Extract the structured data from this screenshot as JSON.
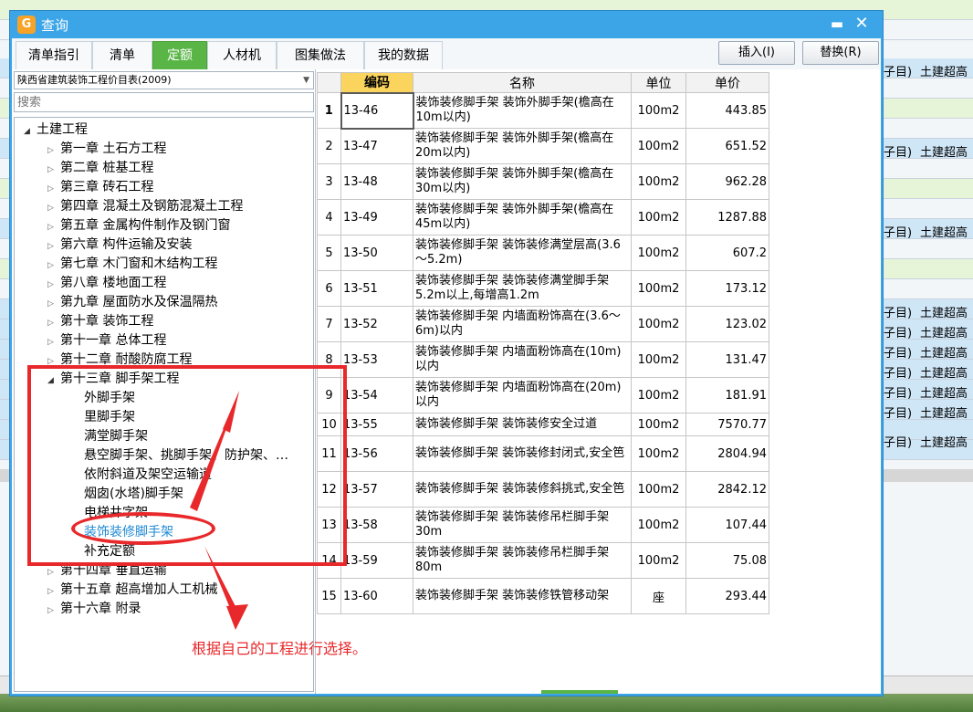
{
  "window": {
    "title": "查询",
    "icon": "app-icon"
  },
  "tabs": [
    "清单指引",
    "清单",
    "定额",
    "人材机",
    "图集做法",
    "我的数据"
  ],
  "active_tab": "定额",
  "buttons": {
    "insert": "插入(I)",
    "replace": "替换(R)"
  },
  "library": {
    "selected": "陕西省建筑装饰工程价目表(2009)"
  },
  "search": {
    "placeholder": "搜索"
  },
  "tree": {
    "root": "土建工程",
    "chapters": [
      "第一章 土石方工程",
      "第二章 桩基工程",
      "第三章 砖石工程",
      "第四章 混凝土及钢筋混凝土工程",
      "第五章 金属构件制作及钢门窗",
      "第六章 构件运输及安装",
      "第七章 木门窗和木结构工程",
      "第八章 楼地面工程",
      "第九章 屋面防水及保温隔热",
      "第十章 装饰工程",
      "第十一章 总体工程",
      "第十二章 耐酸防腐工程"
    ],
    "open_chapter": "第十三章 脚手架工程",
    "open_children": [
      "外脚手架",
      "里脚手架",
      "满堂脚手架",
      "悬空脚手架、挑脚手架、防护架、…",
      "依附斜道及架空运输道",
      "烟囱(水塔)脚手架",
      "电梯井字架",
      "装饰装修脚手架",
      "补充定额"
    ],
    "selected_child": "装饰装修脚手架",
    "after_chapters": [
      "第十四章 垂直运输",
      "第十五章 超高增加人工机械",
      "第十六章 附录"
    ]
  },
  "grid": {
    "headers": {
      "code": "编码",
      "name": "名称",
      "unit": "单位",
      "price": "单价"
    },
    "rows": [
      {
        "n": "1",
        "code": "13-46",
        "name": "装饰装修脚手架 装饰外脚手架(檐高在10m以内)",
        "unit": "100m2",
        "price": "443.85"
      },
      {
        "n": "2",
        "code": "13-47",
        "name": "装饰装修脚手架 装饰外脚手架(檐高在20m以内)",
        "unit": "100m2",
        "price": "651.52"
      },
      {
        "n": "3",
        "code": "13-48",
        "name": "装饰装修脚手架 装饰外脚手架(檐高在30m以内)",
        "unit": "100m2",
        "price": "962.28"
      },
      {
        "n": "4",
        "code": "13-49",
        "name": "装饰装修脚手架 装饰外脚手架(檐高在45m以内)",
        "unit": "100m2",
        "price": "1287.88"
      },
      {
        "n": "5",
        "code": "13-50",
        "name": "装饰装修脚手架 装饰装修满堂层高(3.6～5.2m)",
        "unit": "100m2",
        "price": "607.2"
      },
      {
        "n": "6",
        "code": "13-51",
        "name": "装饰装修脚手架 装饰装修满堂脚手架5.2m以上,每增高1.2m",
        "unit": "100m2",
        "price": "173.12"
      },
      {
        "n": "7",
        "code": "13-52",
        "name": "装饰装修脚手架 内墙面粉饰高在(3.6～6m)以内",
        "unit": "100m2",
        "price": "123.02"
      },
      {
        "n": "8",
        "code": "13-53",
        "name": "装饰装修脚手架 内墙面粉饰高在(10m)以内",
        "unit": "100m2",
        "price": "131.47"
      },
      {
        "n": "9",
        "code": "13-54",
        "name": "装饰装修脚手架 内墙面粉饰高在(20m)以内",
        "unit": "100m2",
        "price": "181.91"
      },
      {
        "n": "10",
        "code": "13-55",
        "name": "装饰装修脚手架 装饰装修安全过道",
        "unit": "100m2",
        "price": "7570.77"
      },
      {
        "n": "11",
        "code": "13-56",
        "name": "装饰装修脚手架 装饰装修封闭式,安全笆",
        "unit": "100m2",
        "price": "2804.94"
      },
      {
        "n": "12",
        "code": "13-57",
        "name": "装饰装修脚手架 装饰装修斜挑式,安全笆",
        "unit": "100m2",
        "price": "2842.12"
      },
      {
        "n": "13",
        "code": "13-58",
        "name": "装饰装修脚手架 装饰装修吊栏脚手架30m",
        "unit": "100m2",
        "price": "107.44"
      },
      {
        "n": "14",
        "code": "13-59",
        "name": "装饰装修脚手架 装饰装修吊栏脚手架80m",
        "unit": "100m2",
        "price": "75.08"
      },
      {
        "n": "15",
        "code": "13-60",
        "name": "装饰装修脚手架 装饰装修铁管移动架",
        "unit": "座",
        "price": "293.44"
      }
    ]
  },
  "annotation": {
    "text": "根据自己的工程进行选择。",
    "color": "#e8282a"
  },
  "background": {
    "right_text_a": "子目)",
    "right_text_b": "土建超高"
  },
  "colors": {
    "title_bar": "#3ba5e8",
    "active_tab": "#5ab547",
    "header_highlight": "#fbd45e"
  }
}
